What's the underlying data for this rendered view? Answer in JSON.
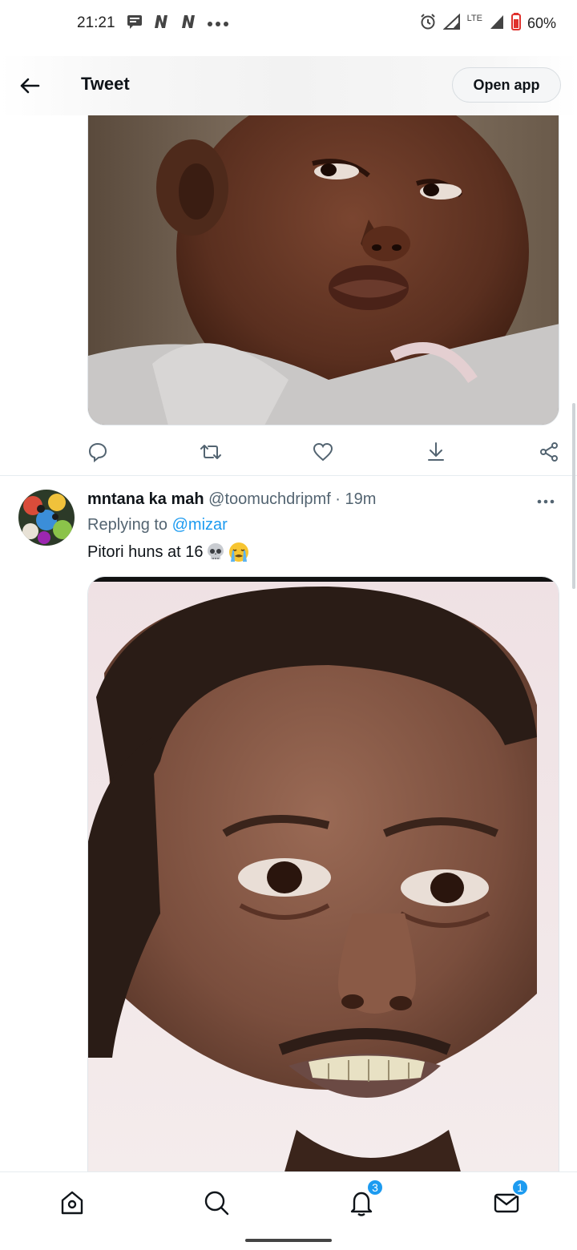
{
  "status_bar": {
    "time": "21:21",
    "notification_icons": [
      "message-icon",
      "netflix-icon",
      "netflix-icon",
      "more-dots-icon"
    ],
    "battery_percent": "60%",
    "network": "LTE"
  },
  "header": {
    "title": "Tweet",
    "open_app_label": "Open app"
  },
  "tweet": {
    "name": "mntana ka mah",
    "handle": "@toomuchdripmf",
    "separator": " · ",
    "time": "19m",
    "replying_prefix": "Replying to ",
    "reply_to": "@mizar",
    "text": "Pitori huns at 16"
  },
  "bottom_nav": {
    "notifications_badge": "3",
    "messages_badge": "1"
  },
  "colors": {
    "accent": "#1d9bf0",
    "secondary_text": "#536471",
    "primary_text": "#0f1419"
  }
}
